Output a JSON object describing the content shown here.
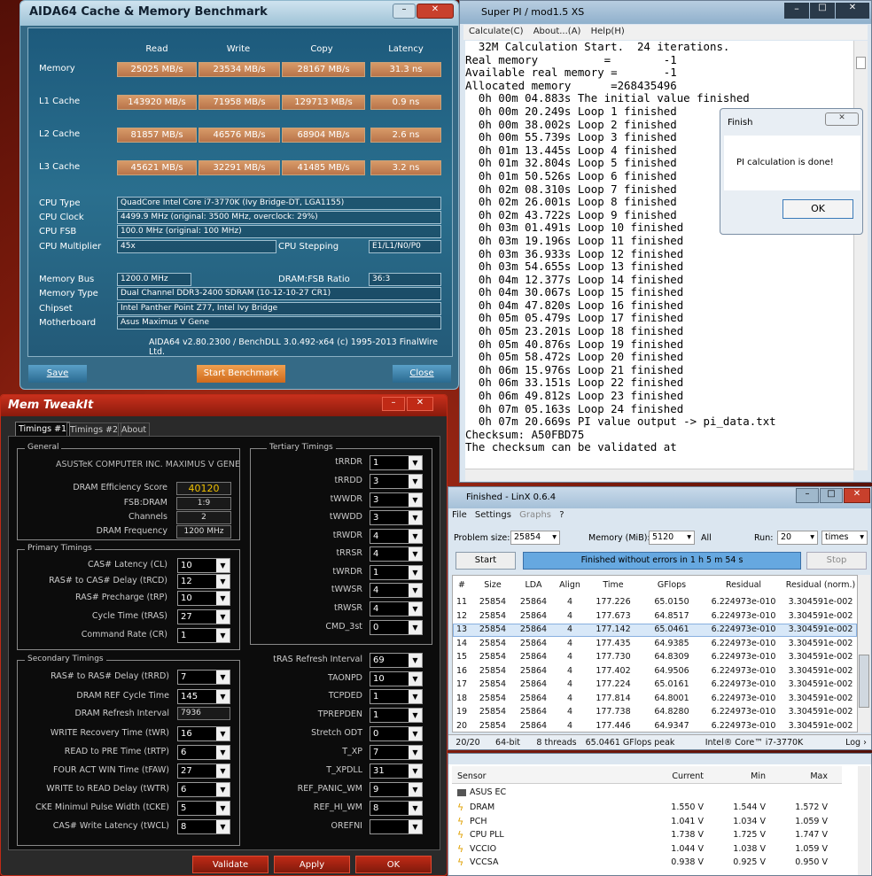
{
  "aida": {
    "title": "AIDA64 Cache & Memory Benchmark",
    "cols": [
      "Read",
      "Write",
      "Copy",
      "Latency"
    ],
    "rows": [
      {
        "label": "Memory",
        "vals": [
          "25025 MB/s",
          "23534 MB/s",
          "28167 MB/s",
          "31.3 ns"
        ]
      },
      {
        "label": "L1 Cache",
        "vals": [
          "143920 MB/s",
          "71958 MB/s",
          "129713 MB/s",
          "0.9 ns"
        ]
      },
      {
        "label": "L2 Cache",
        "vals": [
          "81857 MB/s",
          "46576 MB/s",
          "68904 MB/s",
          "2.6 ns"
        ]
      },
      {
        "label": "L3 Cache",
        "vals": [
          "45621 MB/s",
          "32291 MB/s",
          "41485 MB/s",
          "3.2 ns"
        ]
      }
    ],
    "cpu_type_label": "CPU Type",
    "cpu_type": "QuadCore Intel Core i7-3770K  (Ivy Bridge-DT, LGA1155)",
    "cpu_clock_label": "CPU Clock",
    "cpu_clock": "4499.9 MHz  (original: 3500 MHz, overclock: 29%)",
    "cpu_fsb_label": "CPU FSB",
    "cpu_fsb": "100.0 MHz  (original: 100 MHz)",
    "cpu_mult_label": "CPU Multiplier",
    "cpu_mult": "45x",
    "cpu_step_label": "CPU Stepping",
    "cpu_step": "E1/L1/N0/P0",
    "mem_bus_label": "Memory Bus",
    "mem_bus": "1200.0 MHz",
    "dram_fsb_label": "DRAM:FSB Ratio",
    "dram_fsb": "36:3",
    "mem_type_label": "Memory Type",
    "mem_type": "Dual Channel DDR3-2400 SDRAM  (10-12-10-27 CR1)",
    "chipset_label": "Chipset",
    "chipset": "Intel Panther Point Z77, Intel Ivy Bridge",
    "mobo_label": "Motherboard",
    "mobo": "Asus Maximus V Gene",
    "version": "AIDA64 v2.80.2300 / BenchDLL 3.0.492-x64  (c) 1995-2013 FinalWire Ltd.",
    "save": "Save",
    "start": "Start Benchmark",
    "close": "Close"
  },
  "spi": {
    "title": "Super PI / mod1.5 XS",
    "menu": [
      "Calculate(C)",
      "About...(A)",
      "Help(H)"
    ],
    "lines": [
      "  32M Calculation Start.  24 iterations.",
      "Real memory          =        -1",
      "Available real memory =       -1",
      "Allocated memory      =268435496",
      "  0h 00m 04.883s The initial value finished",
      "  0h 00m 20.249s Loop 1 finished",
      "  0h 00m 38.002s Loop 2 finished",
      "  0h 00m 55.739s Loop 3 finished",
      "  0h 01m 13.445s Loop 4 finished",
      "  0h 01m 32.804s Loop 5 finished",
      "  0h 01m 50.526s Loop 6 finished",
      "  0h 02m 08.310s Loop 7 finished",
      "  0h 02m 26.001s Loop 8 finished",
      "  0h 02m 43.722s Loop 9 finished",
      "  0h 03m 01.491s Loop 10 finished",
      "  0h 03m 19.196s Loop 11 finished",
      "  0h 03m 36.933s Loop 12 finished",
      "  0h 03m 54.655s Loop 13 finished",
      "  0h 04m 12.377s Loop 14 finished",
      "  0h 04m 30.067s Loop 15 finished",
      "  0h 04m 47.820s Loop 16 finished",
      "  0h 05m 05.479s Loop 17 finished",
      "  0h 05m 23.201s Loop 18 finished",
      "  0h 05m 40.876s Loop 19 finished",
      "  0h 05m 58.472s Loop 20 finished",
      "  0h 06m 15.976s Loop 21 finished",
      "  0h 06m 33.151s Loop 22 finished",
      "  0h 06m 49.812s Loop 23 finished",
      "  0h 07m 05.163s Loop 24 finished",
      "  0h 07m 20.669s PI value output -> pi_data.txt",
      "",
      "Checksum: A50FBD75",
      "The checksum can be validated at"
    ]
  },
  "finish": {
    "title": "Finish",
    "message": "PI calculation is done!",
    "ok": "OK"
  },
  "mem": {
    "title": "Mem TweakIt",
    "tabs": [
      "Timings #1",
      "Timings #2",
      "About"
    ],
    "general": "General",
    "board": "ASUSTeK COMPUTER INC. MAXIMUS V GENE",
    "gen_rows": [
      {
        "label": "DRAM Efficiency Score",
        "value": "40120"
      },
      {
        "label": "FSB:DRAM",
        "value": "1:9"
      },
      {
        "label": "Channels",
        "value": "2"
      },
      {
        "label": "DRAM Frequency",
        "value": "1200 MHz"
      }
    ],
    "primary": "Primary Timings",
    "prim_rows": [
      {
        "label": "CAS# Latency (CL)",
        "value": "10"
      },
      {
        "label": "RAS# to CAS# Delay (tRCD)",
        "value": "12"
      },
      {
        "label": "RAS# Precharge (tRP)",
        "value": "10"
      },
      {
        "label": "Cycle Time (tRAS)",
        "value": "27"
      },
      {
        "label": "Command Rate (CR)",
        "value": "1"
      }
    ],
    "tertiary": "Tertiary Timings",
    "tert_rows": [
      {
        "label": "tRRDR",
        "value": "1"
      },
      {
        "label": "tRRDD",
        "value": "3"
      },
      {
        "label": "tWWDR",
        "value": "3"
      },
      {
        "label": "tWWDD",
        "value": "3"
      },
      {
        "label": "tRWDR",
        "value": "4"
      },
      {
        "label": "tRRSR",
        "value": "4"
      },
      {
        "label": "tWRDR",
        "value": "1"
      },
      {
        "label": "tWWSR",
        "value": "4"
      },
      {
        "label": "tRWSR",
        "value": "4"
      },
      {
        "label": "CMD_3st",
        "value": "0"
      }
    ],
    "secondary": "Secondary Timings",
    "sec_rows": [
      {
        "label": "RAS# to RAS# Delay (tRRD)",
        "value": "7"
      },
      {
        "label": "DRAM REF Cycle Time",
        "value": "145"
      },
      {
        "label": "DRAM Refresh Interval",
        "value": "7936"
      },
      {
        "label": "WRITE Recovery Time (tWR)",
        "value": "16"
      },
      {
        "label": "READ to PRE Time (tRTP)",
        "value": "6"
      },
      {
        "label": "FOUR ACT WIN Time (tFAW)",
        "value": "27"
      },
      {
        "label": "WRITE to READ Delay (tWTR)",
        "value": "6"
      },
      {
        "label": "CKE Minimul Pulse Width (tCKE)",
        "value": "5"
      },
      {
        "label": "CAS# Write Latency (tWCL)",
        "value": "8"
      }
    ],
    "right_rows": [
      {
        "label": "tRAS Refresh Interval",
        "value": "69"
      },
      {
        "label": "TAONPD",
        "value": "10"
      },
      {
        "label": "TCPDED",
        "value": "1"
      },
      {
        "label": "TPREPDEN",
        "value": "1"
      },
      {
        "label": "Stretch ODT",
        "value": "0"
      },
      {
        "label": "T_XP",
        "value": "7"
      },
      {
        "label": "T_XPDLL",
        "value": "31"
      },
      {
        "label": "REF_PANIC_WM",
        "value": "9"
      },
      {
        "label": "REF_HI_WM",
        "value": "8"
      },
      {
        "label": "OREFNI",
        "value": ""
      }
    ],
    "validate": "Validate",
    "apply": "Apply",
    "ok": "OK"
  },
  "linx": {
    "title": "Finished - LinX 0.6.4",
    "menu": [
      "File",
      "Settings",
      "Graphs",
      "?"
    ],
    "problem_label": "Problem size:",
    "problem": "25854",
    "memory_label": "Memory (MiB):",
    "memory": "5120",
    "all": "All",
    "run_label": "Run:",
    "run": "20",
    "times": "times",
    "start": "Start",
    "status": "Finished without errors in 1 h 5 m 54 s",
    "stop": "Stop",
    "cols": [
      "#",
      "Size",
      "LDA",
      "Align",
      "Time",
      "GFlops",
      "Residual",
      "Residual (norm.)"
    ],
    "rows": [
      [
        "11",
        "25854",
        "25864",
        "4",
        "177.226",
        "65.0150",
        "6.224973e-010",
        "3.304591e-002"
      ],
      [
        "12",
        "25854",
        "25864",
        "4",
        "177.673",
        "64.8517",
        "6.224973e-010",
        "3.304591e-002"
      ],
      [
        "13",
        "25854",
        "25864",
        "4",
        "177.142",
        "65.0461",
        "6.224973e-010",
        "3.304591e-002"
      ],
      [
        "14",
        "25854",
        "25864",
        "4",
        "177.435",
        "64.9385",
        "6.224973e-010",
        "3.304591e-002"
      ],
      [
        "15",
        "25854",
        "25864",
        "4",
        "177.730",
        "64.8309",
        "6.224973e-010",
        "3.304591e-002"
      ],
      [
        "16",
        "25854",
        "25864",
        "4",
        "177.402",
        "64.9506",
        "6.224973e-010",
        "3.304591e-002"
      ],
      [
        "17",
        "25854",
        "25864",
        "4",
        "177.224",
        "65.0161",
        "6.224973e-010",
        "3.304591e-002"
      ],
      [
        "18",
        "25854",
        "25864",
        "4",
        "177.814",
        "64.8001",
        "6.224973e-010",
        "3.304591e-002"
      ],
      [
        "19",
        "25854",
        "25864",
        "4",
        "177.738",
        "64.8280",
        "6.224973e-010",
        "3.304591e-002"
      ],
      [
        "20",
        "25854",
        "25864",
        "4",
        "177.446",
        "64.9347",
        "6.224973e-010",
        "3.304591e-002"
      ]
    ],
    "foot": [
      "20/20",
      "64-bit",
      "8 threads",
      "65.0461 GFlops peak",
      "Intel® Core™ i7-3770K",
      "Log ›"
    ]
  },
  "sensor": {
    "cols": [
      "Sensor",
      "Current",
      "Min",
      "Max"
    ],
    "group": "ASUS EC",
    "rows": [
      [
        "DRAM",
        "1.550 V",
        "1.544 V",
        "1.572 V"
      ],
      [
        "PCH",
        "1.041 V",
        "1.034 V",
        "1.059 V"
      ],
      [
        "CPU PLL",
        "1.738 V",
        "1.725 V",
        "1.747 V"
      ],
      [
        "VCCIO",
        "1.044 V",
        "1.038 V",
        "1.059 V"
      ],
      [
        "VCCSA",
        "0.938 V",
        "0.925 V",
        "0.950 V"
      ]
    ]
  }
}
